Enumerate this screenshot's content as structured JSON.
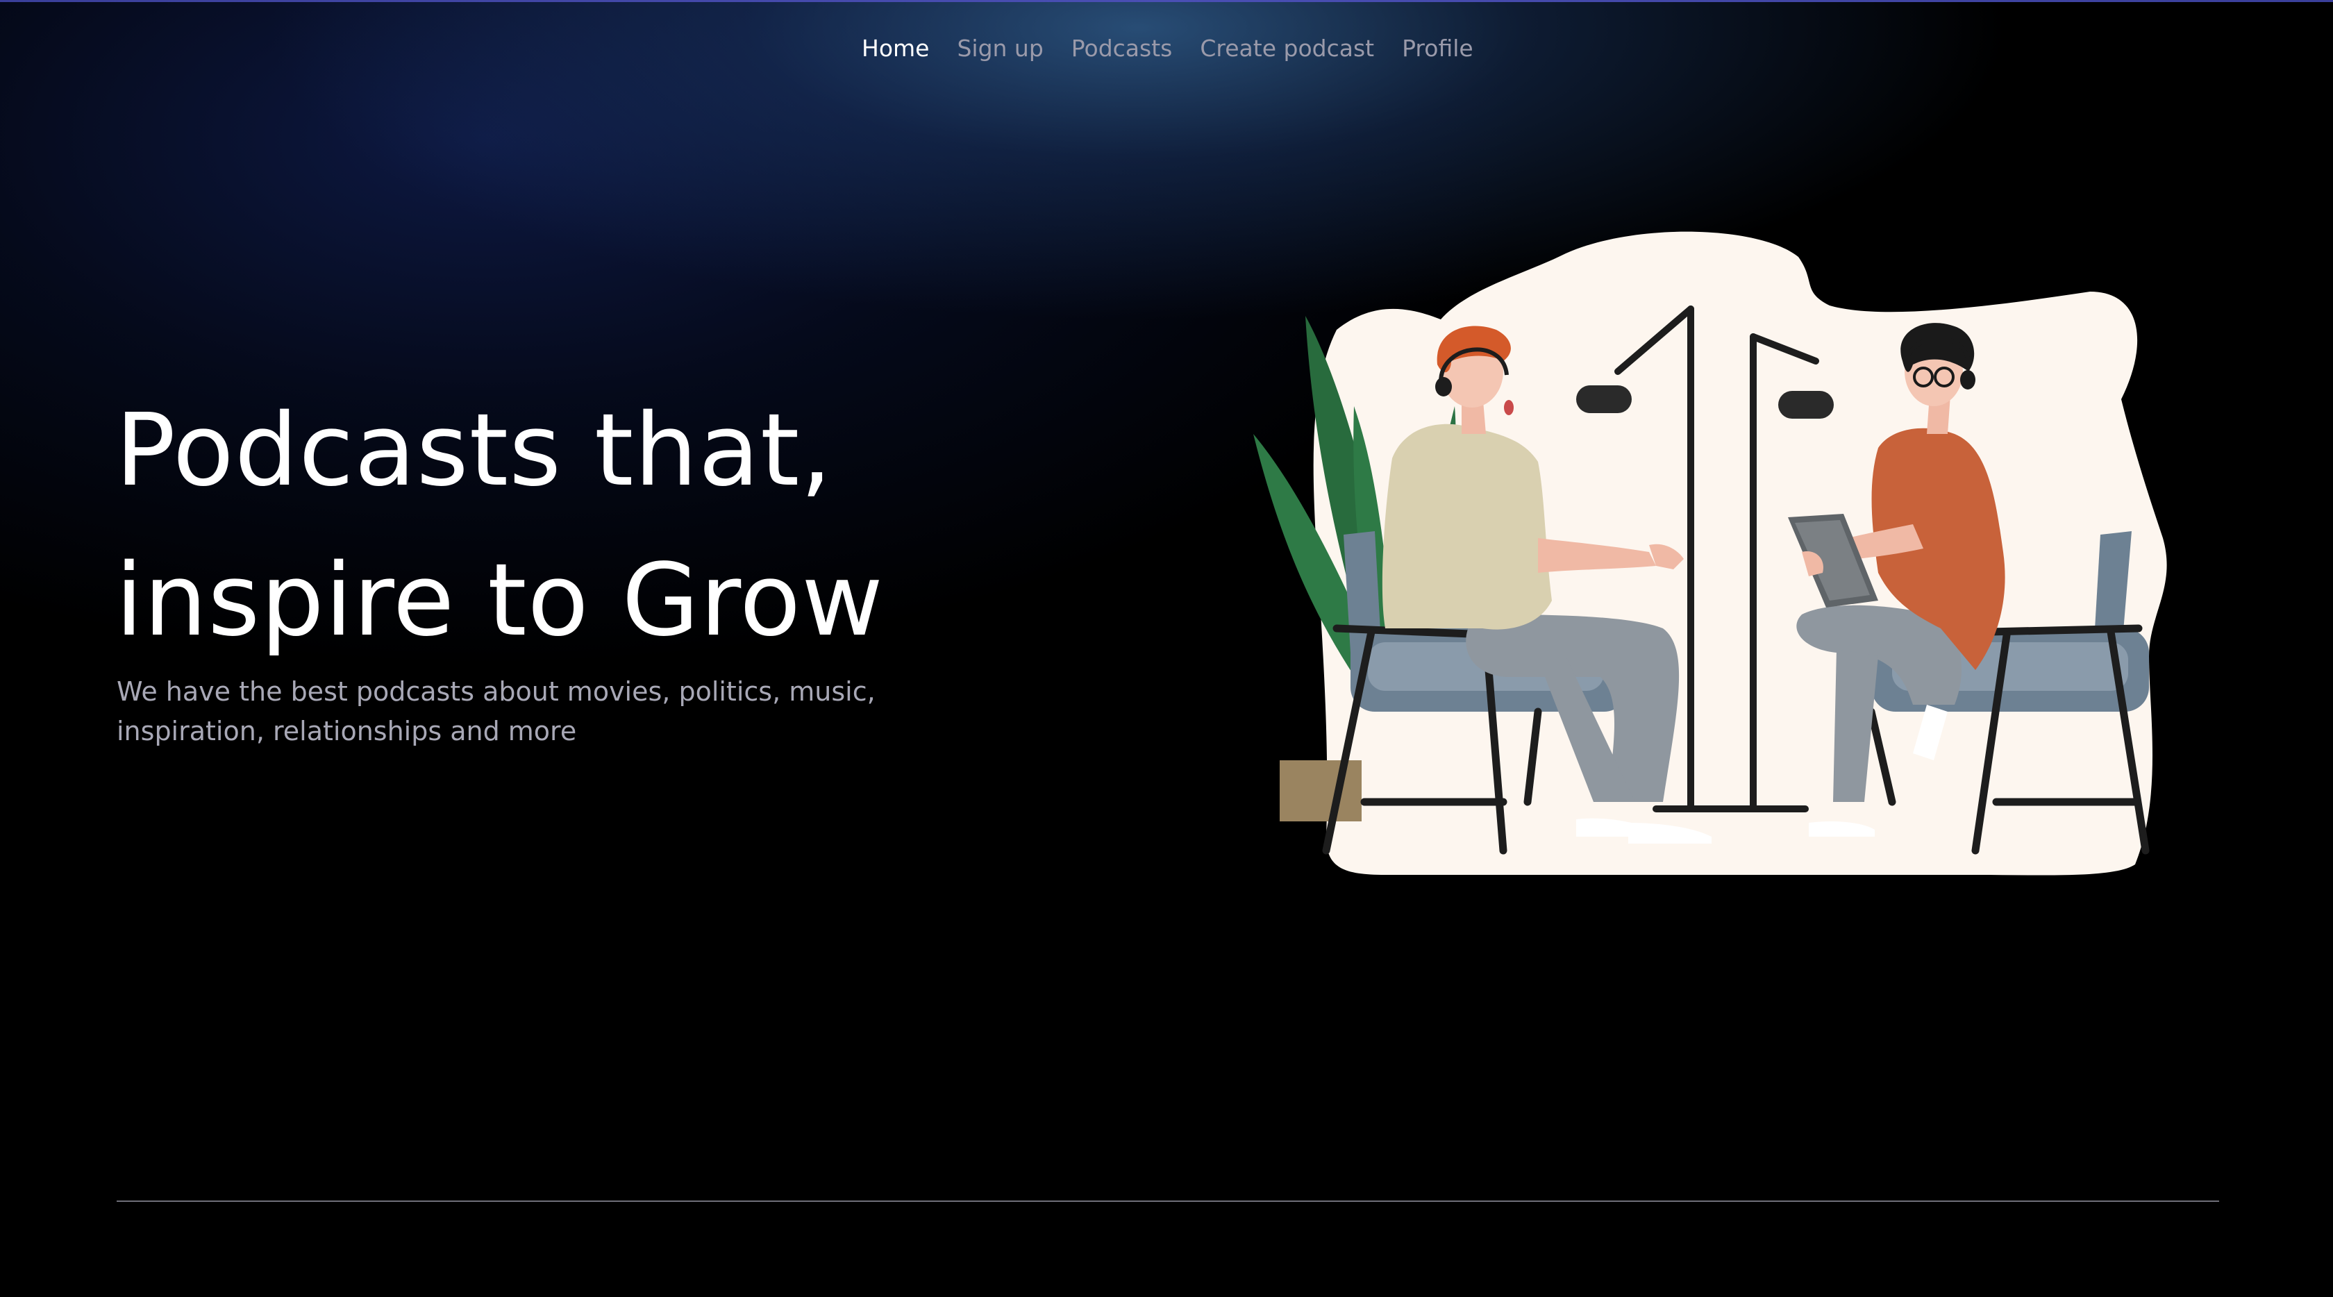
{
  "nav": {
    "items": [
      {
        "label": "Home",
        "active": true
      },
      {
        "label": "Sign up",
        "active": false
      },
      {
        "label": "Podcasts",
        "active": false
      },
      {
        "label": "Create podcast",
        "active": false
      },
      {
        "label": "Profile",
        "active": false
      }
    ]
  },
  "hero": {
    "title_line1": "Podcasts that,",
    "title_line2": "inspire to Grow",
    "subtitle": "We have the best podcasts about movies, politics, music, inspiration, relationships and more"
  },
  "illustration": {
    "icon": "podcast-illustration",
    "colors": {
      "blob": "#fdf6ef",
      "plant": "#2e7a46",
      "pot": "#9a8460",
      "chair": "#6d8193",
      "left_shirt": "#d9d0b0",
      "right_shirt": "#c8623a",
      "hair_left": "#d45a2a",
      "hair_right": "#1a1a1a",
      "pants": "#8f979f",
      "stand": "#1d1d1d"
    }
  },
  "theme": {
    "background": "#000000",
    "glow": "#2e5a8e",
    "accent_line": "#3a3f9a"
  }
}
